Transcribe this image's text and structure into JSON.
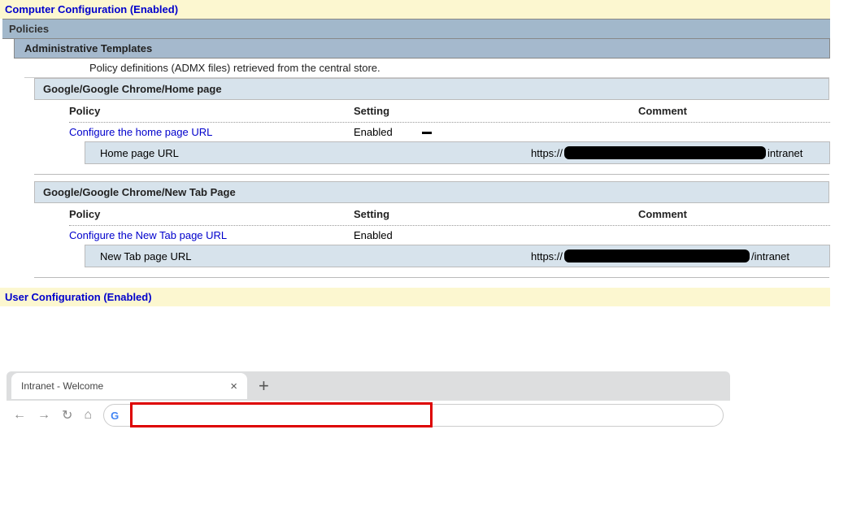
{
  "header_computer": "Computer Configuration (Enabled)",
  "policies": "Policies",
  "admin_templates": "Administrative Templates",
  "policy_defs": "Policy definitions (ADMX files) retrieved from the central store.",
  "columns": {
    "policy": "Policy",
    "setting": "Setting",
    "comment": "Comment"
  },
  "home": {
    "path": "Google/Google Chrome/Home page",
    "link": "Configure the home page URL",
    "setting": "Enabled",
    "sub_label": "Home page URL",
    "url_prefix": "https://",
    "url_suffix": "intranet"
  },
  "newtab": {
    "path": "Google/Google Chrome/New Tab Page",
    "link": "Configure the New Tab page URL",
    "setting": "Enabled",
    "sub_label": "New Tab page URL",
    "url_prefix": "https://",
    "url_suffix": "/intranet"
  },
  "header_user": "User Configuration (Enabled)",
  "browser": {
    "tab_title": "Intranet - Welcome",
    "close_glyph": "×",
    "plus_glyph": "+",
    "back": "←",
    "forward": "→",
    "reload": "↻",
    "home": "⌂",
    "url_value": ""
  }
}
